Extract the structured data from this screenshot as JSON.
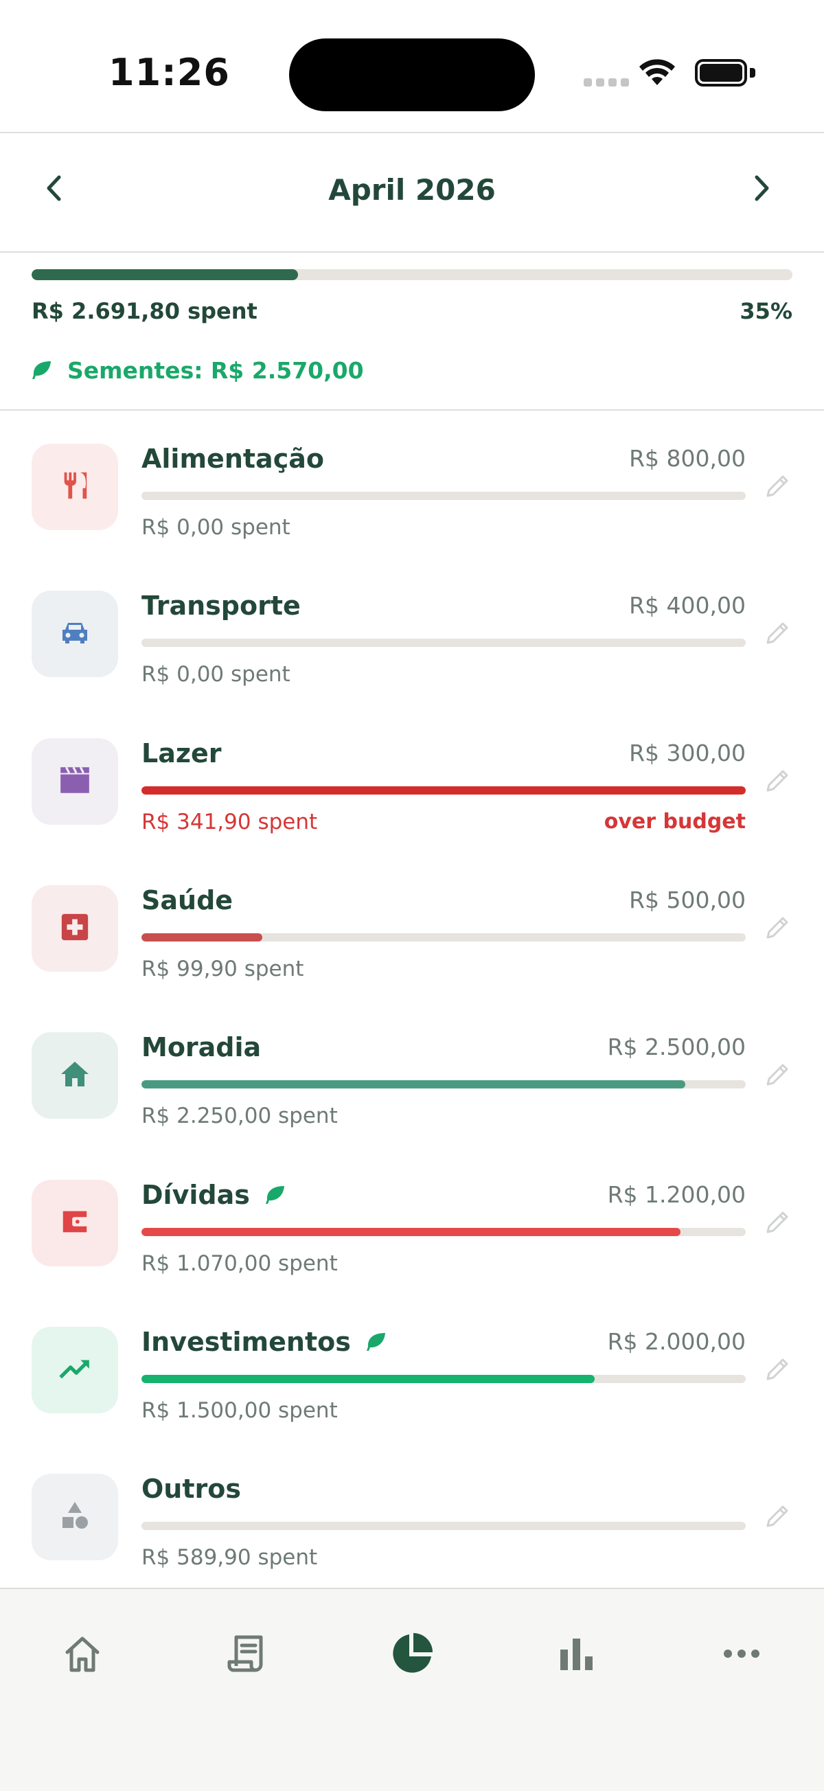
{
  "status_bar": {
    "time": "11:26"
  },
  "header": {
    "month": "April 2026",
    "prev_icon": "chevron-left-icon",
    "next_icon": "chevron-right-icon"
  },
  "summary": {
    "spent_label": "R$ 2.691,80 spent",
    "percent_label": "35%",
    "progress_fraction": 0.35,
    "seeds_label": "Sementes: R$ 2.570,00",
    "seeds_icon": "leaf-icon",
    "bar_color": "#2f6a4f"
  },
  "categories": [
    {
      "name": "Alimentação",
      "budget": "R$ 800,00",
      "spent": "R$ 0,00 spent",
      "progress": 0,
      "over_label": "",
      "icon": "restaurant-icon",
      "icon_color": "#e0534a",
      "bg": "#fbeceb",
      "bar": "#e0534a",
      "leaf": false
    },
    {
      "name": "Transporte",
      "budget": "R$ 400,00",
      "spent": "R$ 0,00 spent",
      "progress": 0,
      "over_label": "",
      "icon": "car-icon",
      "icon_color": "#4f7fbf",
      "bg": "#ecf0f3",
      "bar": "#4f7fbf",
      "leaf": false
    },
    {
      "name": "Lazer",
      "budget": "R$ 300,00",
      "spent": "R$ 341,90 spent",
      "progress": 1,
      "over_label": "over budget",
      "icon": "clapperboard-icon",
      "icon_color": "#8a5fb0",
      "bg": "#f1eef4",
      "bar": "#d42c2c",
      "leaf": false
    },
    {
      "name": "Saúde",
      "budget": "R$ 500,00",
      "spent": "R$ 99,90 spent",
      "progress": 0.2,
      "over_label": "",
      "icon": "medical-kit-icon",
      "icon_color": "#c94446",
      "bg": "#f8ecec",
      "bar": "#c94f4f",
      "leaf": false
    },
    {
      "name": "Moradia",
      "budget": "R$ 2.500,00",
      "spent": "R$ 2.250,00 spent",
      "progress": 0.9,
      "over_label": "",
      "icon": "home-icon",
      "icon_color": "#3f8f7b",
      "bg": "#e8f1ee",
      "bar": "#4a9a82",
      "leaf": false
    },
    {
      "name": "Dívidas",
      "budget": "R$ 1.200,00",
      "spent": "R$ 1.070,00 spent",
      "progress": 0.892,
      "over_label": "",
      "icon": "wallet-icon",
      "icon_color": "#e04446",
      "bg": "#fbe9e9",
      "bar": "#e54848",
      "leaf": true
    },
    {
      "name": "Investimentos",
      "budget": "R$ 2.000,00",
      "spent": "R$ 1.500,00 spent",
      "progress": 0.75,
      "over_label": "",
      "icon": "trending-up-icon",
      "icon_color": "#1aa86a",
      "bg": "#e4f6ee",
      "bar": "#16b36e",
      "leaf": true
    },
    {
      "name": "Outros",
      "budget": "",
      "spent": "R$ 589,90 spent",
      "progress": 0,
      "over_label": "",
      "icon": "shapes-icon",
      "icon_color": "#9aa0a3",
      "bg": "#f0f1f2",
      "bar": "#9aa0a3",
      "leaf": false
    }
  ],
  "tabbar": {
    "tabs": [
      {
        "icon": "home-outline-icon",
        "active": false
      },
      {
        "icon": "receipt-icon",
        "active": false
      },
      {
        "icon": "pie-chart-icon",
        "active": true
      },
      {
        "icon": "bar-chart-icon",
        "active": false
      },
      {
        "icon": "more-icon",
        "active": false
      }
    ],
    "active_color": "#23553f",
    "inactive_color": "#6f7a76"
  }
}
